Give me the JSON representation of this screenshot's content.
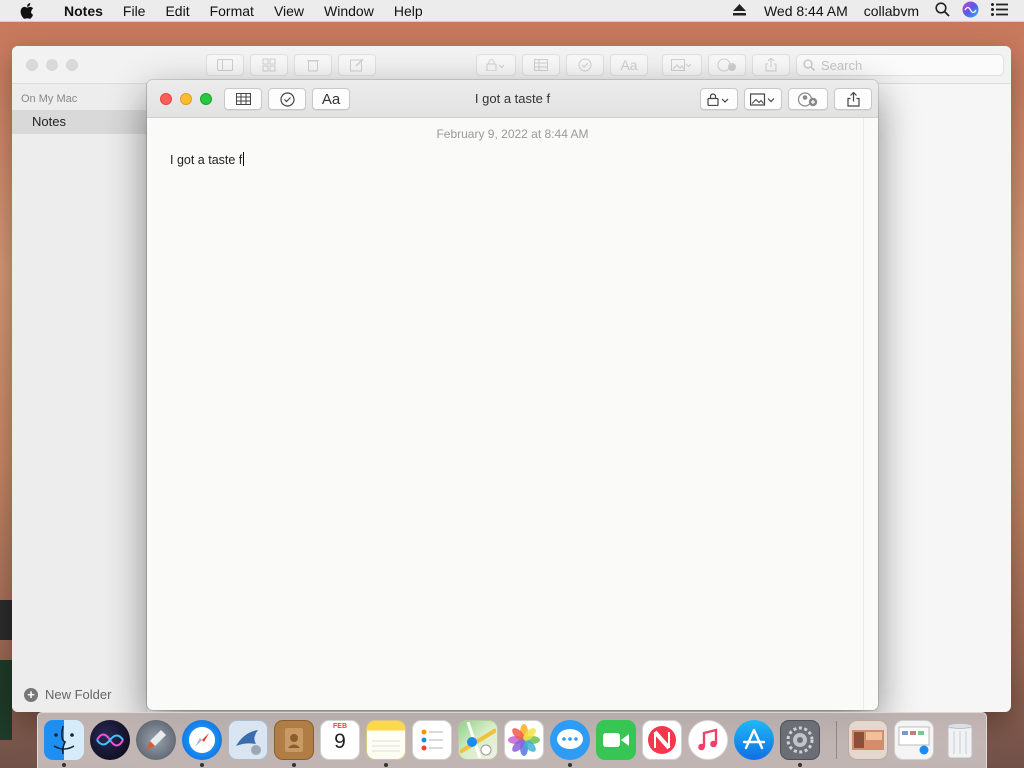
{
  "menubar": {
    "app_name": "Notes",
    "items": [
      "File",
      "Edit",
      "Format",
      "View",
      "Window",
      "Help"
    ],
    "clock": "Wed 8:44 AM",
    "user": "collabvm"
  },
  "bg_window": {
    "search_placeholder": "Search",
    "sidebar_section": "On My Mac",
    "sidebar_item": "Notes",
    "new_folder_label": "New Folder"
  },
  "note_window": {
    "title": "I got a taste f",
    "date": "February 9, 2022 at 8:44 AM",
    "body_text": "I got a taste f",
    "format_button_label": "Aa"
  },
  "dock": {
    "calendar_month": "FEB",
    "calendar_day": "9",
    "apps": [
      "finder",
      "siri",
      "launchpad",
      "safari",
      "mail",
      "contacts",
      "calendar",
      "notes",
      "reminders",
      "maps",
      "photos",
      "messages",
      "facetime",
      "news",
      "music",
      "app-store",
      "system-preferences"
    ]
  }
}
